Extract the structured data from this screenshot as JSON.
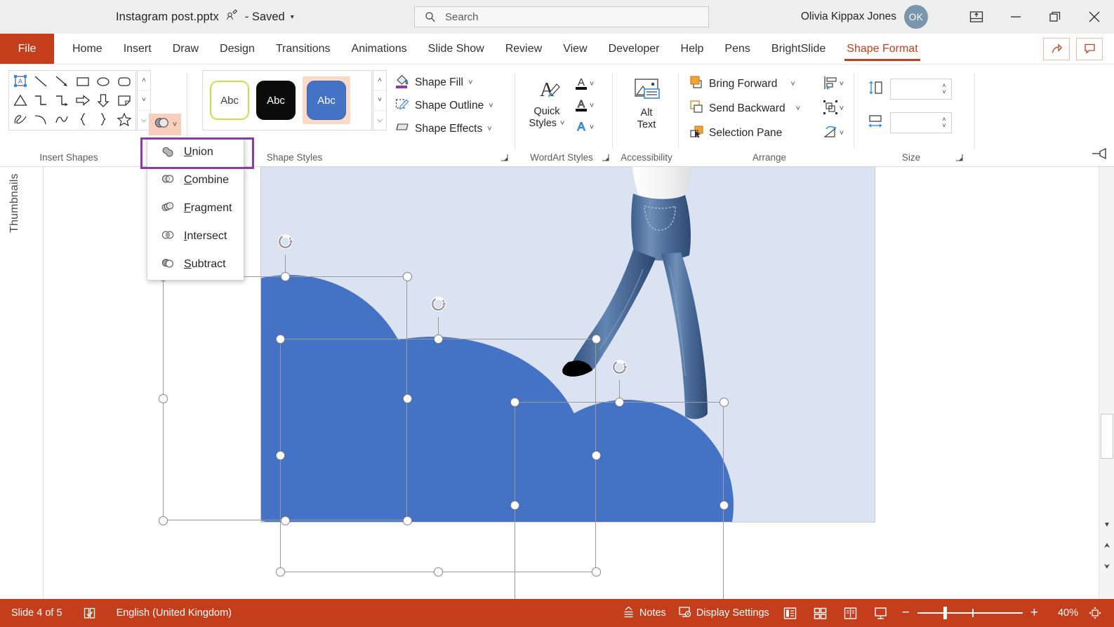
{
  "titlebar": {
    "filename": "Instagram post.pptx",
    "persona_icon": "person-pen-icon",
    "saved_status": "- Saved",
    "caret": "▾",
    "search_placeholder": "Search",
    "search_icon": "search-icon",
    "username": "Olivia Kippax Jones",
    "avatar_initials": "OK",
    "ribbon_display_icon": "ribbon-display-options-icon",
    "minimize_icon": "minimize-icon",
    "restore_icon": "restore-icon",
    "close_icon": "close-icon"
  },
  "tabs": {
    "file": "File",
    "items": [
      "Home",
      "Insert",
      "Draw",
      "Design",
      "Transitions",
      "Animations",
      "Slide Show",
      "Review",
      "View",
      "Developer",
      "Help",
      "Pens",
      "BrightSlide"
    ],
    "active": "Shape Format",
    "share_icon": "share-icon",
    "comments_icon": "comment-icon"
  },
  "ribbon": {
    "groups": [
      {
        "label": "Insert Shapes"
      },
      {
        "label": "Shape Styles"
      },
      {
        "label": "WordArt Styles"
      },
      {
        "label": "Accessibility"
      },
      {
        "label": "Arrange"
      },
      {
        "label": "Size"
      }
    ],
    "insert_shapes": {
      "shape_icons": [
        "textbox-shape-icon",
        "line-shape-icon",
        "arrow-line-shape-icon",
        "rectangle-shape-icon",
        "oval-shape-icon",
        "rounded-rectangle-shape-icon",
        "triangle-shape-icon",
        "elbow-connector-shape-icon",
        "elbow-arrow-connector-shape-icon",
        "right-arrow-shape-icon",
        "down-arrow-shape-icon",
        "folded-corner-shape-icon",
        "scribble-shape-icon",
        "curve-shape-icon",
        "arc-shape-icon",
        "left-brace-shape-icon",
        "right-brace-shape-icon",
        "star-shape-icon"
      ],
      "gallery_up": "˄",
      "gallery_down": "˅",
      "gallery_more": "⌵",
      "edit_shape_icon": "edit-shape-icon",
      "text_box_icon": "text-box-icon",
      "merge_shapes_icon": "merge-shapes-icon"
    },
    "shape_styles": {
      "samples": [
        {
          "text": "Abc",
          "style": "outline-lime"
        },
        {
          "text": "Abc",
          "style": "fill-black"
        },
        {
          "text": "Abc",
          "style": "fill-blue",
          "selected": true
        }
      ],
      "gallery_up": "˄",
      "gallery_down": "˅",
      "gallery_more": "⌵",
      "shape_fill": "Shape Fill",
      "shape_outline": "Shape Outline",
      "shape_effects": "Shape Effects",
      "shape_fill_icon": "paint-bucket-icon",
      "shape_outline_icon": "pen-outline-icon",
      "shape_effects_icon": "shape-effects-icon",
      "chevron": "˅"
    },
    "wordart": {
      "quick_styles_line1": "Quick",
      "quick_styles_line2": "Styles",
      "quick_styles_icon": "wordart-quick-styles-icon",
      "text_fill_icon": "text-fill-icon",
      "text_outline_icon": "text-outline-icon",
      "text_effects_icon": "text-effects-icon",
      "chevron": "˅"
    },
    "accessibility": {
      "alt_text_line1": "Alt",
      "alt_text_line2": "Text",
      "alt_text_icon": "alt-text-icon"
    },
    "arrange": {
      "bring_forward": "Bring Forward",
      "send_backward": "Send Backward",
      "selection_pane": "Selection Pane",
      "bring_forward_icon": "bring-forward-icon",
      "send_backward_icon": "send-backward-icon",
      "selection_pane_icon": "selection-pane-icon",
      "align_icon": "align-objects-icon",
      "group_icon": "group-objects-icon",
      "rotate_icon": "rotate-objects-icon",
      "chevron": "˅"
    },
    "size": {
      "height_icon": "shape-height-icon",
      "width_icon": "shape-width-icon",
      "height_value": "",
      "width_value": "",
      "spin_up": "˄",
      "spin_down": "˅"
    },
    "dialog_launcher_icon": "dialog-launcher-icon"
  },
  "merge_menu": {
    "items": [
      {
        "accel": "U",
        "rest": "nion",
        "icon": "union-icon",
        "highlighted": true
      },
      {
        "accel": "C",
        "rest": "ombine",
        "icon": "combine-icon",
        "highlighted": false
      },
      {
        "accel": "F",
        "rest": "ragment",
        "icon": "fragment-icon",
        "highlighted": false
      },
      {
        "accel": "I",
        "rest": "ntersect",
        "icon": "intersect-icon",
        "highlighted": false
      },
      {
        "accel": "S",
        "rest": "ubtract",
        "icon": "subtract-icon",
        "highlighted": false
      }
    ],
    "highlight_color": "#8a3ba6"
  },
  "left_pane": {
    "label": "Thumbnails"
  },
  "canvas": {
    "slide_background": "#dbe3f3",
    "shape_fill": "#4472c4",
    "photo_alt": "woman-walking-photo",
    "shapes": [
      {
        "name": "ellipse-1",
        "selected": true
      },
      {
        "name": "ellipse-2",
        "selected": true
      },
      {
        "name": "ellipse-3",
        "selected": true
      }
    ],
    "rotate_handle_icon": "rotate-handle-icon",
    "pin_icon": "pin-ribbon-icon"
  },
  "scrollbar": {
    "down_arrow": "▼",
    "prev_slide": "⮝",
    "next_slide": "⮟"
  },
  "statusbar": {
    "slide_counter": "Slide 4 of 5",
    "spellcheck_icon": "spellcheck-icon",
    "language": "English (United Kingdom)",
    "notes": "Notes",
    "notes_icon": "notes-icon",
    "display_settings": "Display Settings",
    "display_settings_icon": "display-settings-icon",
    "view_normal_icon": "normal-view-icon",
    "view_sorter_icon": "slide-sorter-icon",
    "view_reading_icon": "reading-view-icon",
    "view_slideshow_icon": "slide-show-icon",
    "zoom_out": "−",
    "zoom_in": "+",
    "zoom_level": "40%",
    "fit_slide_icon": "fit-to-window-icon"
  }
}
